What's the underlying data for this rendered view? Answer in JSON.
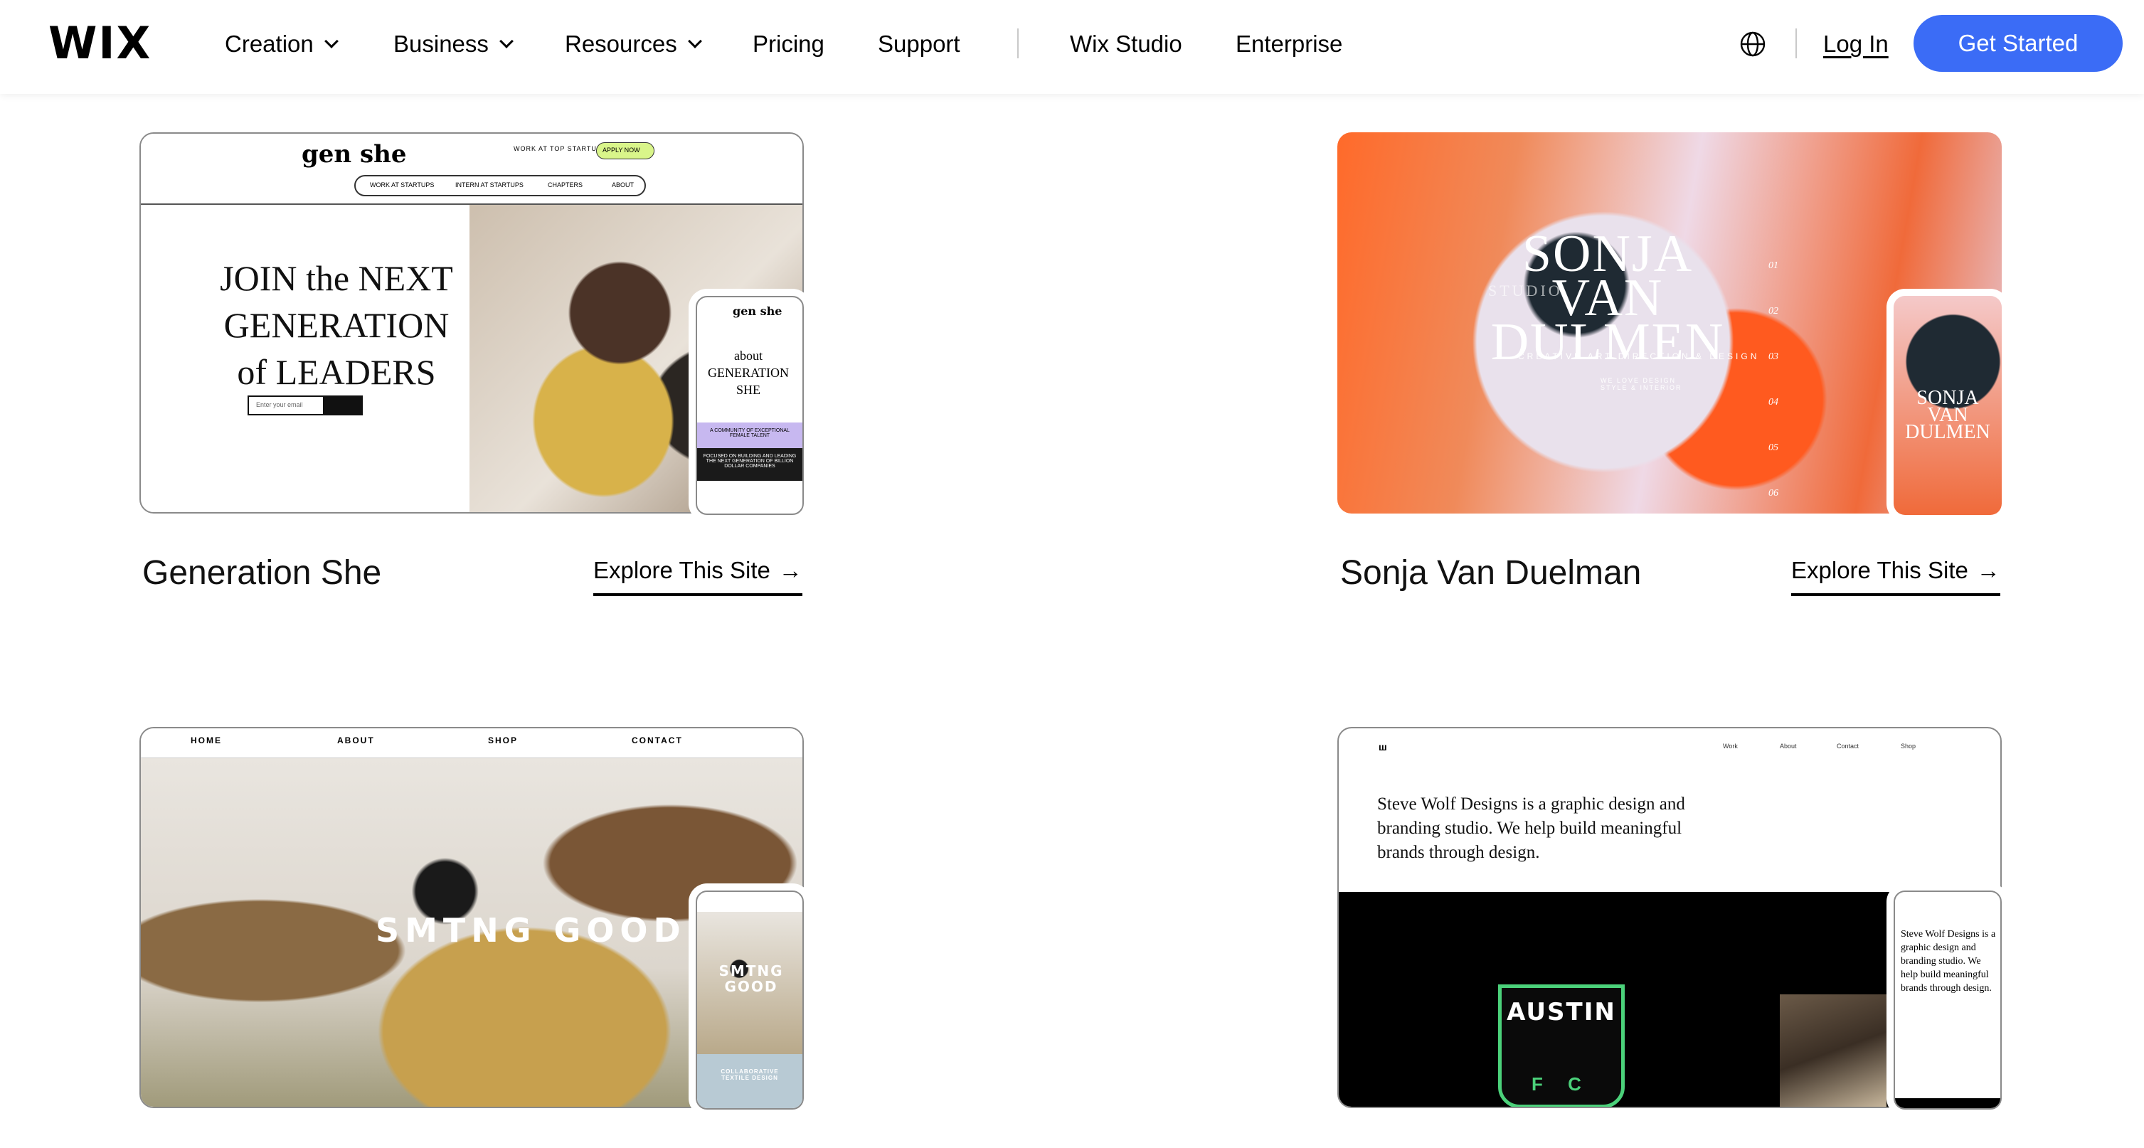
{
  "header": {
    "logo": "WIX",
    "nav": [
      {
        "label": "Creation",
        "dropdown": true
      },
      {
        "label": "Business",
        "dropdown": true
      },
      {
        "label": "Resources",
        "dropdown": true
      },
      {
        "label": "Pricing",
        "dropdown": false
      },
      {
        "label": "Support",
        "dropdown": false
      },
      {
        "label": "Wix Studio",
        "dropdown": false
      },
      {
        "label": "Enterprise",
        "dropdown": false
      }
    ],
    "login": "Log In",
    "cta": "Get Started",
    "cta_color": "#3b6cf6",
    "language_icon": "globe-icon"
  },
  "cards": [
    {
      "title": "Generation She",
      "explore": "Explore This Site",
      "preview": {
        "logo": "gen she",
        "nav": [
          "WORK AT STARTUPS",
          "INTERN AT STARTUPS",
          "CHAPTERS",
          "ABOUT"
        ],
        "top_link": "WORK AT TOP STARTUPS",
        "apply": "APPLY NOW",
        "headline": "JOIN the NEXT GENERATION of LEADERS",
        "email_placeholder": "Enter your email",
        "mobile_heading": "about GENERATION SHE",
        "mobile_tagline": "A COMMUNITY OF EXCEPTIONAL FEMALE TALENT",
        "mobile_footer": "FOCUSED ON BUILDING AND LEADING THE NEXT GENERATION OF BILLION DOLLAR COMPANIES"
      }
    },
    {
      "title": "Sonja Van Duelman",
      "explore": "Explore This Site",
      "preview": {
        "headline": "SONJA VAN DULMEN",
        "studio": "STUDIO",
        "tagline": "CREATIVE ART DIRECTION & DESIGN",
        "sub": "WE LOVE DESIGN STYLE & INTERIOR",
        "numbers": [
          "01",
          "02",
          "03",
          "04",
          "05",
          "06"
        ],
        "mobile_headline": "SONJA VAN DULMEN"
      }
    },
    {
      "title": "",
      "explore": "",
      "preview": {
        "nav": [
          "HOME",
          "ABOUT",
          "SHOP",
          "CONTACT"
        ],
        "logo": "SMTNG GOOD",
        "mobile_caption": "COLLABORATIVE TEXTILE DESIGN"
      }
    },
    {
      "title": "",
      "explore": "",
      "preview": {
        "nav": [
          "Work",
          "About",
          "Contact",
          "Shop"
        ],
        "intro": "Steve Wolf Designs is a graphic design and branding studio. We help build meaningful brands through design.",
        "badge": "AUSTIN",
        "badge_sub": "F C",
        "badge_color": "#4bd17a",
        "mobile_intro": "Steve Wolf Designs is a graphic design and branding studio. We help build meaningful brands through design."
      }
    }
  ]
}
